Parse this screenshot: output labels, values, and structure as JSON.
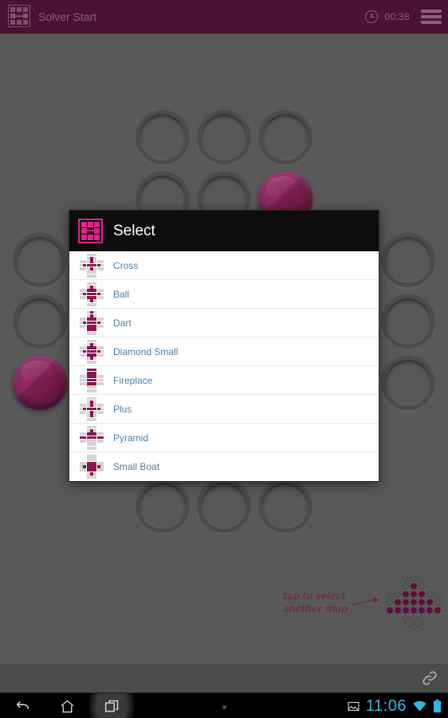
{
  "appbar": {
    "icon": "grid-back-icon",
    "title": "Solver Start",
    "clock_icon": "clock-icon",
    "timer": "00:38",
    "menu_icon": "hamburger-menu-icon",
    "background_color": "#4b1235"
  },
  "dialog": {
    "icon": "grid-back-icon",
    "title": "Select",
    "accent_color": "#e2228c",
    "link_color": "#4a7fa8",
    "items": [
      {
        "label": "Cross",
        "grid": [
          "vv000vv",
          "vv0f0vv",
          "000f000",
          "0fffff0",
          "000f000",
          "vv000vv",
          "vv000vv"
        ]
      },
      {
        "label": "Ball",
        "grid": [
          "vv000vv",
          "vv0f0vv",
          "00fff00",
          "0fffff0",
          "00fff00",
          "vv0f0vv",
          "vv000vv"
        ]
      },
      {
        "label": "Dart",
        "grid": [
          "vv0f0vv",
          "vv0f0vv",
          "00fff00",
          "0fffff0",
          "00fff00",
          "vvfffvv",
          "vv000vv"
        ]
      },
      {
        "label": "Diamond Small",
        "grid": [
          "vv000vv",
          "vv0f0vv",
          "00fff00",
          "0fffff0",
          "00fff00",
          "vv0f0vv",
          "vv000vv"
        ]
      },
      {
        "label": "Fireplace",
        "grid": [
          "vvfffvv",
          "vvfffvv",
          "00fff00",
          "00fff00",
          "00fff00",
          "vv000vv",
          "vv000vv"
        ]
      },
      {
        "label": "Plus",
        "grid": [
          "vv000vv",
          "vv0f0vv",
          "000f000",
          "0fffff0",
          "000f000",
          "vv0f0vv",
          "vv000vv"
        ]
      },
      {
        "label": "Pyramid",
        "grid": [
          "vv000vv",
          "vv0f0vv",
          "00fff00",
          "fffffff",
          "0000000",
          "vv000vv",
          "vv000vv"
        ]
      },
      {
        "label": "Small Boat",
        "grid": [
          "vv000vv",
          "vv000vv",
          "00fff00",
          "0fffff0",
          "00fff00",
          "vv0f0vv",
          "vv000vv"
        ]
      }
    ]
  },
  "board": {
    "peg_color": "#8e2a63",
    "hole_color": "#4b4b4b",
    "grid": [
      "vv000vv",
      "vv00fvv",
      "0000000",
      "0000000",
      "f000000",
      "vv000vv",
      "vv000vv"
    ]
  },
  "hint": {
    "text": "tap to select\nanother map",
    "arrow_icon": "arrow-right-icon",
    "color": "#6e2046",
    "minimap": [
      "vv000vv",
      "vv0f0vv",
      "00fff00",
      "0fffff0",
      "fffffff",
      "vv000vv",
      "vv000vv"
    ]
  },
  "bottom_strip": {
    "link_icon": "link-chain-icon"
  },
  "navbar": {
    "back_icon": "back-arrow-icon",
    "home_icon": "home-icon",
    "recents_icon": "recents-icon",
    "dot_icon": "dot-indicator-icon",
    "screenshot_icon": "image-notification-icon",
    "clock": "11:06",
    "wifi_icon": "wifi-icon",
    "battery_icon": "battery-icon",
    "accent_color": "#33b5e5"
  }
}
